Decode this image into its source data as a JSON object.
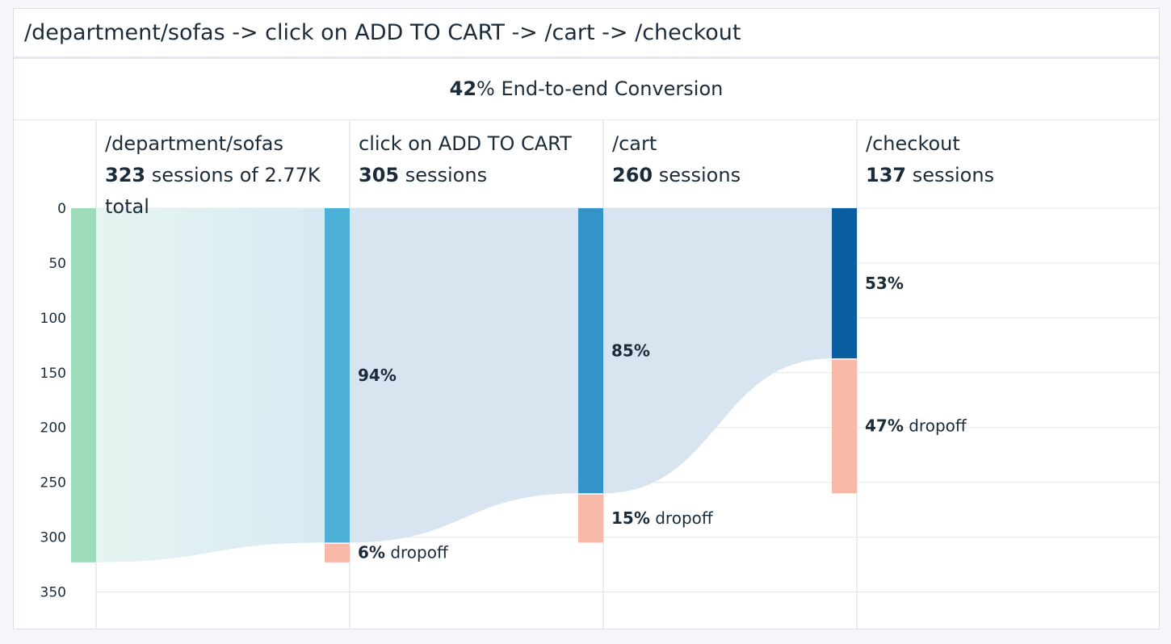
{
  "title": "/department/sofas -> click on ADD TO CART -> /cart -> /checkout",
  "conversion": {
    "value": "42",
    "unit": "%",
    "label": " End-to-end Conversion"
  },
  "colors": {
    "background": "#f5f6f9",
    "grid": "#e4e7ee",
    "entry": "#9fdcb9",
    "steps": [
      "#4bafd6",
      "#3494c7",
      "#0b5e9f"
    ],
    "dropoff": "#f8b9a9",
    "flow": "#d6e3ee",
    "flow_entry_start": "#e7f5f1",
    "flow_entry_end": "#d7eaf3"
  },
  "chart_data": {
    "type": "funnel",
    "ylim": [
      0,
      350
    ],
    "y_ticks": [
      0,
      50,
      100,
      150,
      200,
      250,
      300,
      350
    ],
    "steps": [
      {
        "name": "/department/sofas",
        "sessions": 323,
        "sessions_label": "323",
        "suffix_line1": " sessions of 2.77K",
        "suffix_line2": "total",
        "total": "2.77K"
      },
      {
        "name": "click on ADD TO CART",
        "sessions": 305,
        "sessions_label": "305",
        "suffix_line1": " sessions",
        "conversion_pct": "94%",
        "dropoff": 18,
        "dropoff_pct": "6%"
      },
      {
        "name": "/cart",
        "sessions": 260,
        "sessions_label": "260",
        "suffix_line1": " sessions",
        "conversion_pct": "85%",
        "dropoff": 45,
        "dropoff_pct": "15%"
      },
      {
        "name": "/checkout",
        "sessions": 137,
        "sessions_label": "137",
        "suffix_line1": " sessions",
        "conversion_pct": "53%",
        "dropoff": 123,
        "dropoff_pct": "47%"
      }
    ],
    "dropoff_label": " dropoff"
  }
}
